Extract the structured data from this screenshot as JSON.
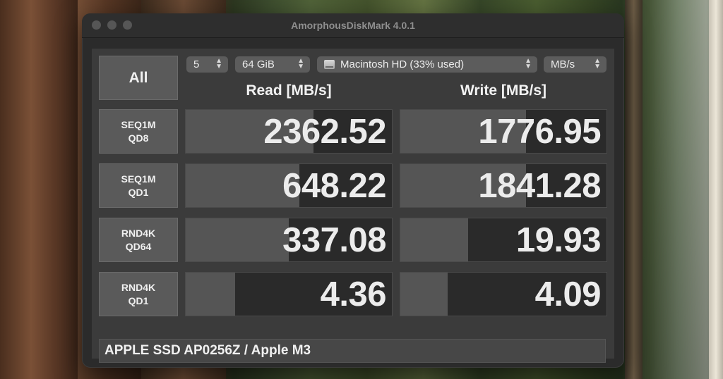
{
  "window": {
    "title": "AmorphousDiskMark 4.0.1"
  },
  "controls": {
    "all_label": "All",
    "count": "5",
    "size": "64 GiB",
    "disk": "Macintosh HD (33% used)",
    "unit": "MB/s"
  },
  "headers": {
    "read": "Read [MB/s]",
    "write": "Write [MB/s]"
  },
  "tests": [
    {
      "line1": "SEQ1M",
      "line2": "QD8",
      "read": "2362.52",
      "write": "1776.95",
      "read_fill": 0.62,
      "write_fill": 0.61
    },
    {
      "line1": "SEQ1M",
      "line2": "QD1",
      "read": "648.22",
      "write": "1841.28",
      "read_fill": 0.55,
      "write_fill": 0.61
    },
    {
      "line1": "RND4K",
      "line2": "QD64",
      "read": "337.08",
      "write": "19.93",
      "read_fill": 0.5,
      "write_fill": 0.33
    },
    {
      "line1": "RND4K",
      "line2": "QD1",
      "read": "4.36",
      "write": "4.09",
      "read_fill": 0.24,
      "write_fill": 0.23
    }
  ],
  "footer": {
    "device": "APPLE SSD AP0256Z / Apple M3"
  },
  "colors": {
    "window_bg": "#2b2b2b",
    "panel_bg": "#3b3b3b",
    "bar_fill": "#555555",
    "text": "#ececec"
  }
}
